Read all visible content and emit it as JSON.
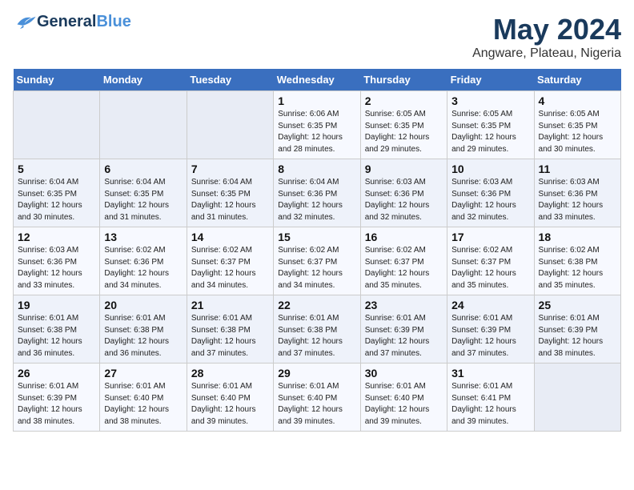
{
  "logo": {
    "text_general": "General",
    "text_blue": "Blue"
  },
  "title": "May 2024",
  "subtitle": "Angware, Plateau, Nigeria",
  "days_of_week": [
    "Sunday",
    "Monday",
    "Tuesday",
    "Wednesday",
    "Thursday",
    "Friday",
    "Saturday"
  ],
  "weeks": [
    [
      {
        "day": "",
        "info": ""
      },
      {
        "day": "",
        "info": ""
      },
      {
        "day": "",
        "info": ""
      },
      {
        "day": "1",
        "info": "Sunrise: 6:06 AM\nSunset: 6:35 PM\nDaylight: 12 hours\nand 28 minutes."
      },
      {
        "day": "2",
        "info": "Sunrise: 6:05 AM\nSunset: 6:35 PM\nDaylight: 12 hours\nand 29 minutes."
      },
      {
        "day": "3",
        "info": "Sunrise: 6:05 AM\nSunset: 6:35 PM\nDaylight: 12 hours\nand 29 minutes."
      },
      {
        "day": "4",
        "info": "Sunrise: 6:05 AM\nSunset: 6:35 PM\nDaylight: 12 hours\nand 30 minutes."
      }
    ],
    [
      {
        "day": "5",
        "info": "Sunrise: 6:04 AM\nSunset: 6:35 PM\nDaylight: 12 hours\nand 30 minutes."
      },
      {
        "day": "6",
        "info": "Sunrise: 6:04 AM\nSunset: 6:35 PM\nDaylight: 12 hours\nand 31 minutes."
      },
      {
        "day": "7",
        "info": "Sunrise: 6:04 AM\nSunset: 6:35 PM\nDaylight: 12 hours\nand 31 minutes."
      },
      {
        "day": "8",
        "info": "Sunrise: 6:04 AM\nSunset: 6:36 PM\nDaylight: 12 hours\nand 32 minutes."
      },
      {
        "day": "9",
        "info": "Sunrise: 6:03 AM\nSunset: 6:36 PM\nDaylight: 12 hours\nand 32 minutes."
      },
      {
        "day": "10",
        "info": "Sunrise: 6:03 AM\nSunset: 6:36 PM\nDaylight: 12 hours\nand 32 minutes."
      },
      {
        "day": "11",
        "info": "Sunrise: 6:03 AM\nSunset: 6:36 PM\nDaylight: 12 hours\nand 33 minutes."
      }
    ],
    [
      {
        "day": "12",
        "info": "Sunrise: 6:03 AM\nSunset: 6:36 PM\nDaylight: 12 hours\nand 33 minutes."
      },
      {
        "day": "13",
        "info": "Sunrise: 6:02 AM\nSunset: 6:36 PM\nDaylight: 12 hours\nand 34 minutes."
      },
      {
        "day": "14",
        "info": "Sunrise: 6:02 AM\nSunset: 6:37 PM\nDaylight: 12 hours\nand 34 minutes."
      },
      {
        "day": "15",
        "info": "Sunrise: 6:02 AM\nSunset: 6:37 PM\nDaylight: 12 hours\nand 34 minutes."
      },
      {
        "day": "16",
        "info": "Sunrise: 6:02 AM\nSunset: 6:37 PM\nDaylight: 12 hours\nand 35 minutes."
      },
      {
        "day": "17",
        "info": "Sunrise: 6:02 AM\nSunset: 6:37 PM\nDaylight: 12 hours\nand 35 minutes."
      },
      {
        "day": "18",
        "info": "Sunrise: 6:02 AM\nSunset: 6:38 PM\nDaylight: 12 hours\nand 35 minutes."
      }
    ],
    [
      {
        "day": "19",
        "info": "Sunrise: 6:01 AM\nSunset: 6:38 PM\nDaylight: 12 hours\nand 36 minutes."
      },
      {
        "day": "20",
        "info": "Sunrise: 6:01 AM\nSunset: 6:38 PM\nDaylight: 12 hours\nand 36 minutes."
      },
      {
        "day": "21",
        "info": "Sunrise: 6:01 AM\nSunset: 6:38 PM\nDaylight: 12 hours\nand 37 minutes."
      },
      {
        "day": "22",
        "info": "Sunrise: 6:01 AM\nSunset: 6:38 PM\nDaylight: 12 hours\nand 37 minutes."
      },
      {
        "day": "23",
        "info": "Sunrise: 6:01 AM\nSunset: 6:39 PM\nDaylight: 12 hours\nand 37 minutes."
      },
      {
        "day": "24",
        "info": "Sunrise: 6:01 AM\nSunset: 6:39 PM\nDaylight: 12 hours\nand 37 minutes."
      },
      {
        "day": "25",
        "info": "Sunrise: 6:01 AM\nSunset: 6:39 PM\nDaylight: 12 hours\nand 38 minutes."
      }
    ],
    [
      {
        "day": "26",
        "info": "Sunrise: 6:01 AM\nSunset: 6:39 PM\nDaylight: 12 hours\nand 38 minutes."
      },
      {
        "day": "27",
        "info": "Sunrise: 6:01 AM\nSunset: 6:40 PM\nDaylight: 12 hours\nand 38 minutes."
      },
      {
        "day": "28",
        "info": "Sunrise: 6:01 AM\nSunset: 6:40 PM\nDaylight: 12 hours\nand 39 minutes."
      },
      {
        "day": "29",
        "info": "Sunrise: 6:01 AM\nSunset: 6:40 PM\nDaylight: 12 hours\nand 39 minutes."
      },
      {
        "day": "30",
        "info": "Sunrise: 6:01 AM\nSunset: 6:40 PM\nDaylight: 12 hours\nand 39 minutes."
      },
      {
        "day": "31",
        "info": "Sunrise: 6:01 AM\nSunset: 6:41 PM\nDaylight: 12 hours\nand 39 minutes."
      },
      {
        "day": "",
        "info": ""
      }
    ]
  ]
}
